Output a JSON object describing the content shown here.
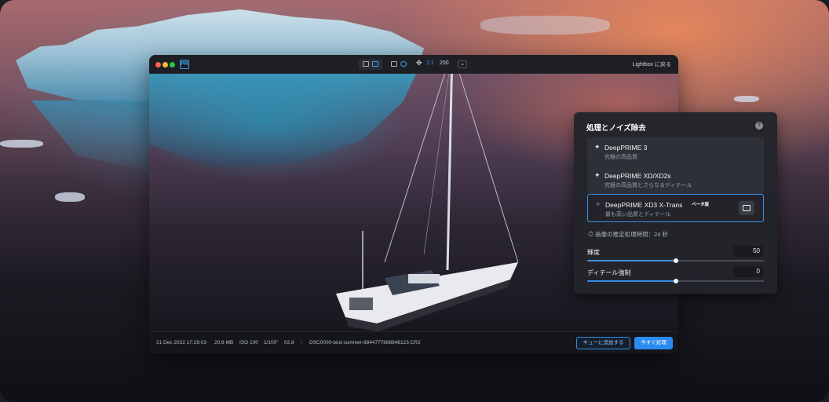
{
  "window": {
    "app_icon_text": "PR",
    "zoom_label": "1:1",
    "zoom_value": "200",
    "lightbox_label": "Lightbox に戻る"
  },
  "status": {
    "date": "21 Dec 2022 17:29:03",
    "size": "20.8 MB",
    "iso": "ISO 100",
    "shutter": "1/100\"",
    "aperture": "f/2.8",
    "filename": "DSC0000-bird-summer-8844777888848123.CR2",
    "queue_button": "キューに追加する",
    "process_button": "今すぐ処理"
  },
  "panel": {
    "title": "処理とノイズ除去",
    "help": "?",
    "models": [
      {
        "name": "DeepPRIME 3",
        "desc": "究極の高品質",
        "icon": "sparkle-icon"
      },
      {
        "name": "DeepPRIME XD/XD2s",
        "desc": "究極の高品質とさらなるディテール",
        "icon": "sparkle-icon"
      },
      {
        "name": "DeepPRIME XD3 X-Trans",
        "badge": "ベータ版",
        "desc": "最も高い品質とディテール",
        "icon": "sparkle-icon"
      }
    ],
    "estimate": "画像の推定処理時間：24 秒",
    "sliders": [
      {
        "label": "輝度",
        "value": "50",
        "level": 0.5
      },
      {
        "label": "ディテール強制",
        "value": "0",
        "level": 0.5
      }
    ]
  },
  "colors": {
    "accent": "#2a8cf0",
    "panel_bg": "#23242a"
  }
}
